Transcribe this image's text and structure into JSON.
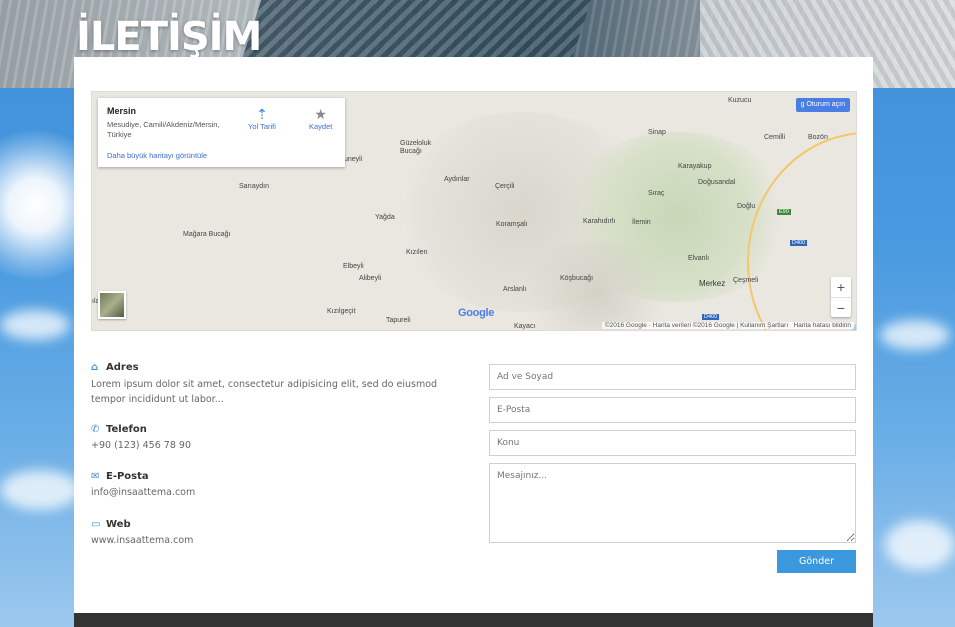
{
  "page": {
    "title": "İLETİŞİM"
  },
  "map": {
    "infobox": {
      "place": "Mersin",
      "address": "Mesudiye, Camili/Akdeniz/Mersin, Türkiye",
      "larger_map_link": "Daha büyük haritayı görüntüle",
      "directions_label": "Yol Tarifi",
      "save_label": "Kaydet"
    },
    "signin_label": "Oturum açın",
    "zoom_in": "+",
    "zoom_out": "−",
    "google_logo": "Google",
    "footer": {
      "copyright": "©2016 Google · Harita verileri ©2016 Google",
      "terms": "Kullanım Şartları",
      "report": "Harita hatası bildirin"
    },
    "places": [
      "Kuzucu",
      "Sinap",
      "Cemilli",
      "Bozön",
      "Güzeloluk Bucağı",
      "Aydınlar",
      "Çerçili",
      "Karayakup",
      "Doğusandal",
      "Sıraç",
      "Doğlu",
      "Sarıaydın",
      "Yağda",
      "Koramşalı",
      "Karahıdırlı",
      "İlemin",
      "Mağara Bucağı",
      "Kızılen",
      "Elbeyli",
      "Alibeyli",
      "Elvanlı",
      "Köşbucağı",
      "Arslanlı",
      "Merkez",
      "Çeşmeli",
      "Kızılgeçit",
      "Tapureli",
      "Kayacı",
      "uneyli",
      "ılar"
    ],
    "road_shields": [
      "E90",
      "D400",
      "D400"
    ]
  },
  "contact": {
    "address": {
      "title": "Adres",
      "text": "Lorem ipsum dolor sit amet, consectetur adipisicing elit, sed do eiusmod tempor incididunt ut labor..."
    },
    "phone": {
      "title": "Telefon",
      "text": "+90 (123) 456 78 90"
    },
    "email": {
      "title": "E-Posta",
      "text": "info@insaattema.com"
    },
    "web": {
      "title": "Web",
      "text": "www.insaattema.com"
    }
  },
  "form": {
    "name_placeholder": "Ad ve Soyad",
    "email_placeholder": "E-Posta",
    "subject_placeholder": "Konu",
    "message_placeholder": "Mesajınız...",
    "submit_label": "Gönder"
  },
  "colors": {
    "accent": "#3b98dc",
    "footer": "#333333",
    "map_link": "#3a6fcf"
  },
  "icons": {
    "address": "home-icon",
    "phone": "phone-icon",
    "email": "envelope-icon",
    "web": "laptop-icon",
    "directions": "directions-icon",
    "save": "star-icon"
  }
}
